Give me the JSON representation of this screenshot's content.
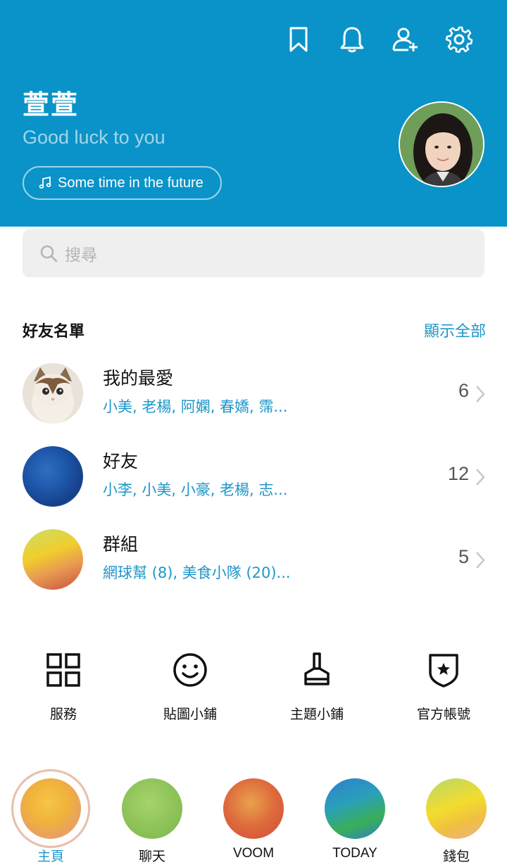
{
  "header": {
    "background_color": "#0a93c8",
    "icons": [
      "bookmark-icon",
      "bell-icon",
      "add-friend-icon",
      "settings-gear-icon"
    ],
    "profile_name": "萱萱",
    "status_message": "Good luck to you",
    "music_label": "Some time in the future",
    "music_icon": "music-note-icon",
    "avatar": "profile-photo-avatar"
  },
  "search": {
    "placeholder": "搜尋",
    "icon": "search-icon"
  },
  "friends": {
    "section_title": "好友名單",
    "show_all": "顯示全部",
    "rows": [
      {
        "title": "我的最愛",
        "subtitle": "小美, 老楊, 阿嫻, 春嬌, 霈...",
        "count": "6",
        "thumb": "cat-photo"
      },
      {
        "title": "好友",
        "subtitle": "小李, 小美, 小豪, 老楊, 志...",
        "count": "12",
        "thumb": "blue-watercolor"
      },
      {
        "title": "群組",
        "subtitle": "網球幫 (8), 美食小隊 (20)...",
        "count": "5",
        "thumb": "yellow-red-watercolor"
      }
    ]
  },
  "shortcuts": [
    {
      "label": "服務",
      "icon": "grid-icon"
    },
    {
      "label": "貼圖小鋪",
      "icon": "smiley-icon"
    },
    {
      "label": "主題小鋪",
      "icon": "brush-icon"
    },
    {
      "label": "官方帳號",
      "icon": "shield-star-icon"
    }
  ],
  "bottom_nav": {
    "active_color": "#1e96c8",
    "items": [
      {
        "label": "主頁",
        "active": true
      },
      {
        "label": "聊天",
        "active": false
      },
      {
        "label": "VOOM",
        "active": false
      },
      {
        "label": "TODAY",
        "active": false
      },
      {
        "label": "錢包",
        "active": false
      }
    ]
  }
}
